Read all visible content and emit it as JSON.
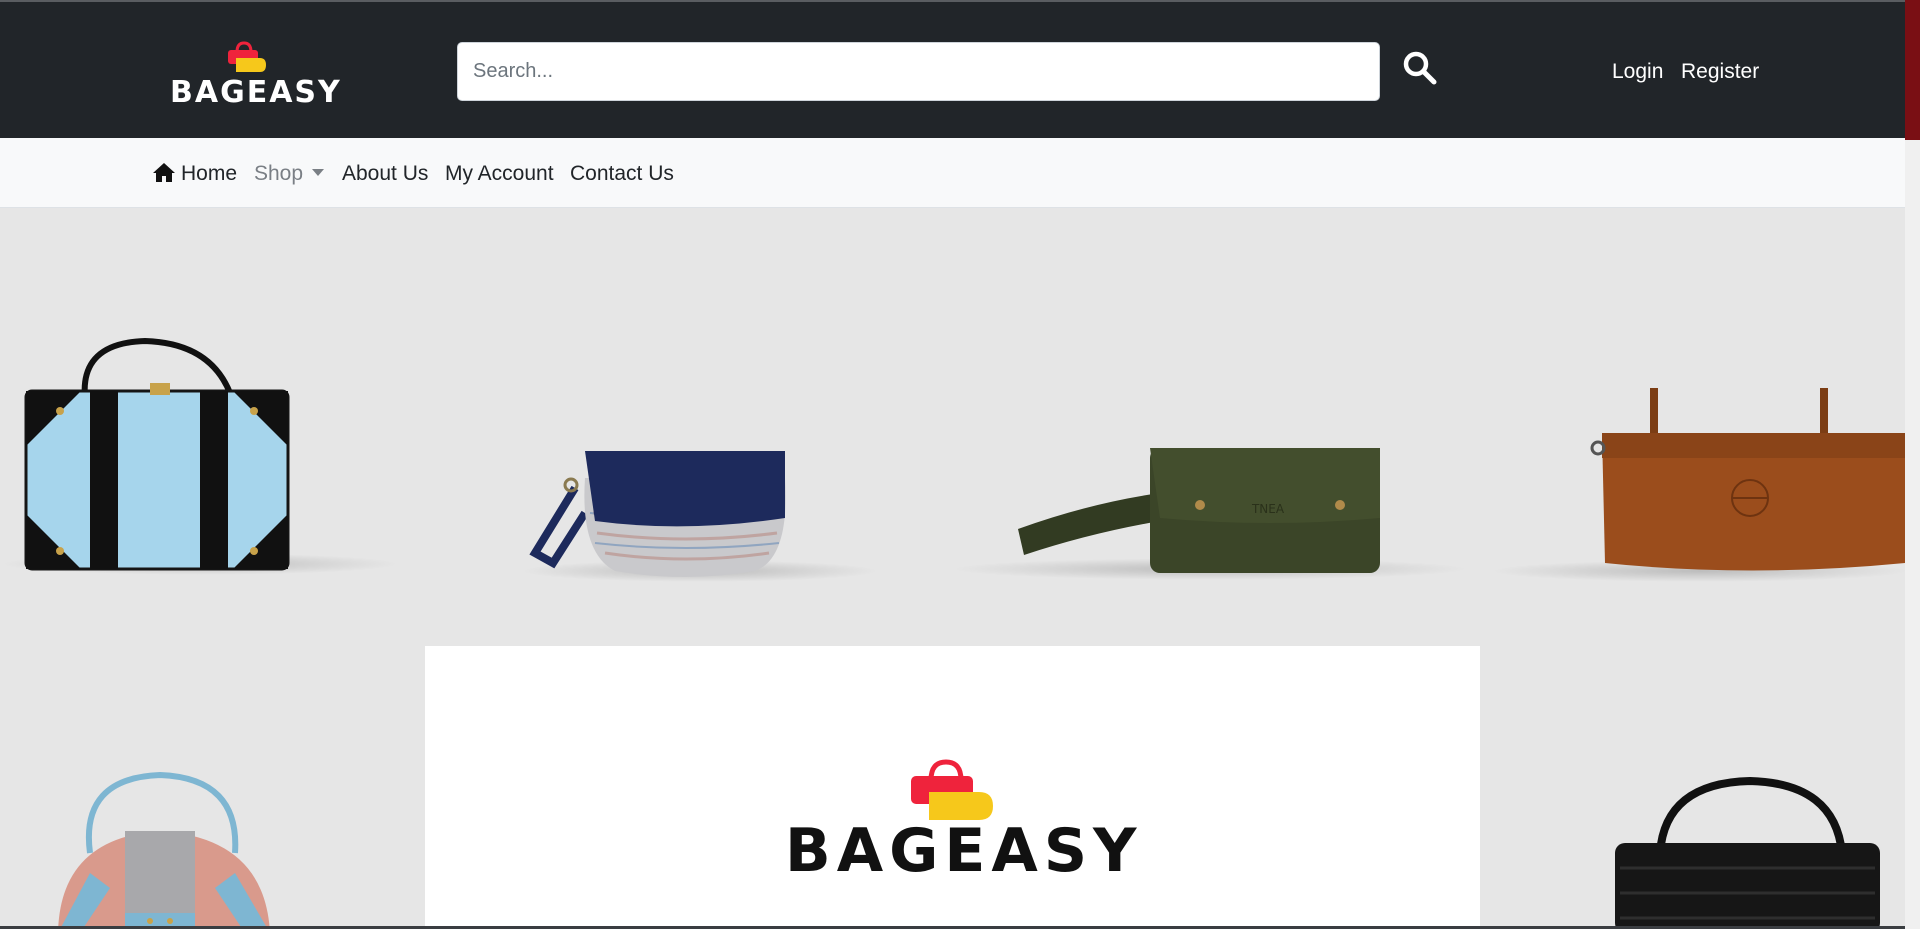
{
  "brand": {
    "name": "BAGEASY"
  },
  "search": {
    "placeholder": "Search..."
  },
  "auth": {
    "login": "Login",
    "register": "Register"
  },
  "nav": {
    "home": "Home",
    "shop": "Shop",
    "about": "About Us",
    "account": "My Account",
    "contact": "Contact Us"
  },
  "icons": {
    "search": "search-icon",
    "home": "home-icon",
    "shop_dropdown": "caret-down-icon"
  },
  "colors": {
    "header_bg": "#212529",
    "nav_bg": "#f8f9fa",
    "hero_bg": "#e6e6e6",
    "logo_red": "#ef233c",
    "logo_yellow": "#f6c81b"
  }
}
